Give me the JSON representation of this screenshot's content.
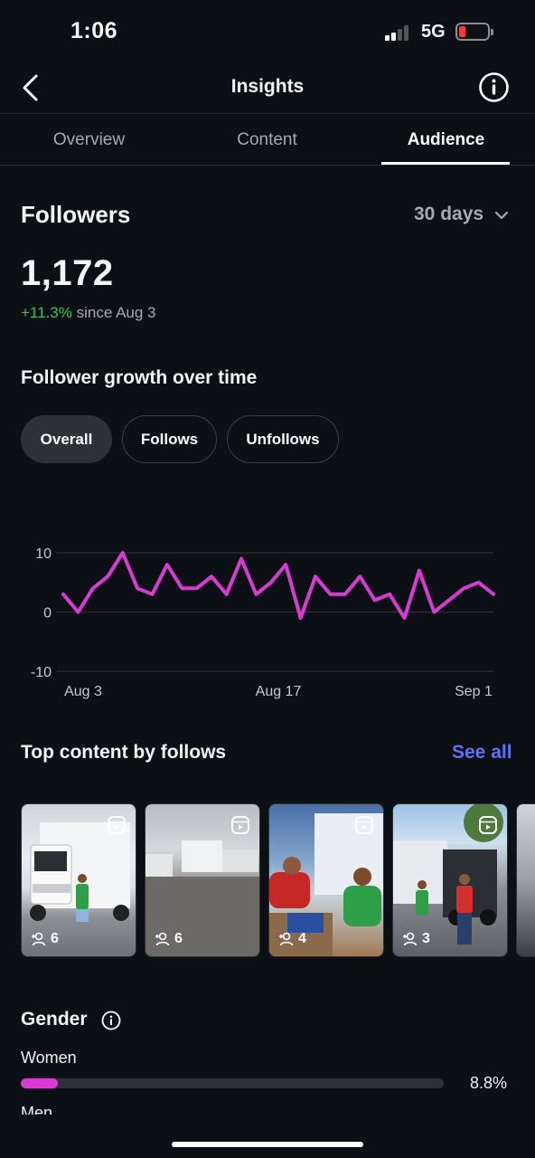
{
  "status_bar": {
    "time": "1:06",
    "network": "5G"
  },
  "header": {
    "title": "Insights",
    "back_icon": "chevron-left-icon",
    "info_icon": "info-circle-icon"
  },
  "tabs": [
    {
      "label": "Overview",
      "active": false
    },
    {
      "label": "Content",
      "active": false
    },
    {
      "label": "Audience",
      "active": true
    }
  ],
  "followers": {
    "heading": "Followers",
    "range": "30 days",
    "count": "1,172",
    "delta": "+11.3%",
    "since": "since Aug 3"
  },
  "growth": {
    "heading": "Follower growth over time",
    "filters": [
      {
        "label": "Overall",
        "active": true
      },
      {
        "label": "Follows",
        "active": false
      },
      {
        "label": "Unfollows",
        "active": false
      }
    ]
  },
  "chart_data": {
    "type": "line",
    "x_ticks": [
      "Aug 3",
      "Aug 17",
      "Sep 1"
    ],
    "y_ticks": [
      10,
      0,
      -10
    ],
    "ylim": [
      -10,
      10
    ],
    "grid": true,
    "series": [
      {
        "color": "#d93ad4",
        "values": [
          3,
          0,
          4,
          6,
          10,
          4,
          3,
          8,
          4,
          4,
          6,
          3,
          9,
          3,
          5,
          8,
          -1,
          6,
          3,
          3,
          6,
          2,
          3,
          -1,
          7,
          0,
          2,
          4,
          5,
          3
        ]
      }
    ]
  },
  "top_content": {
    "heading": "Top content by follows",
    "see_all": "See all",
    "items": [
      {
        "follows": "6"
      },
      {
        "follows": "6"
      },
      {
        "follows": "4"
      },
      {
        "follows": "3"
      }
    ]
  },
  "gender": {
    "heading": "Gender",
    "women_label": "Women",
    "women_pct": "8.8%",
    "women_fraction": 0.088,
    "men_label": "Men"
  },
  "colors": {
    "accent": "#d93ad4",
    "link": "#5b73f4",
    "positive": "#37c063",
    "background": "#0c1014"
  }
}
